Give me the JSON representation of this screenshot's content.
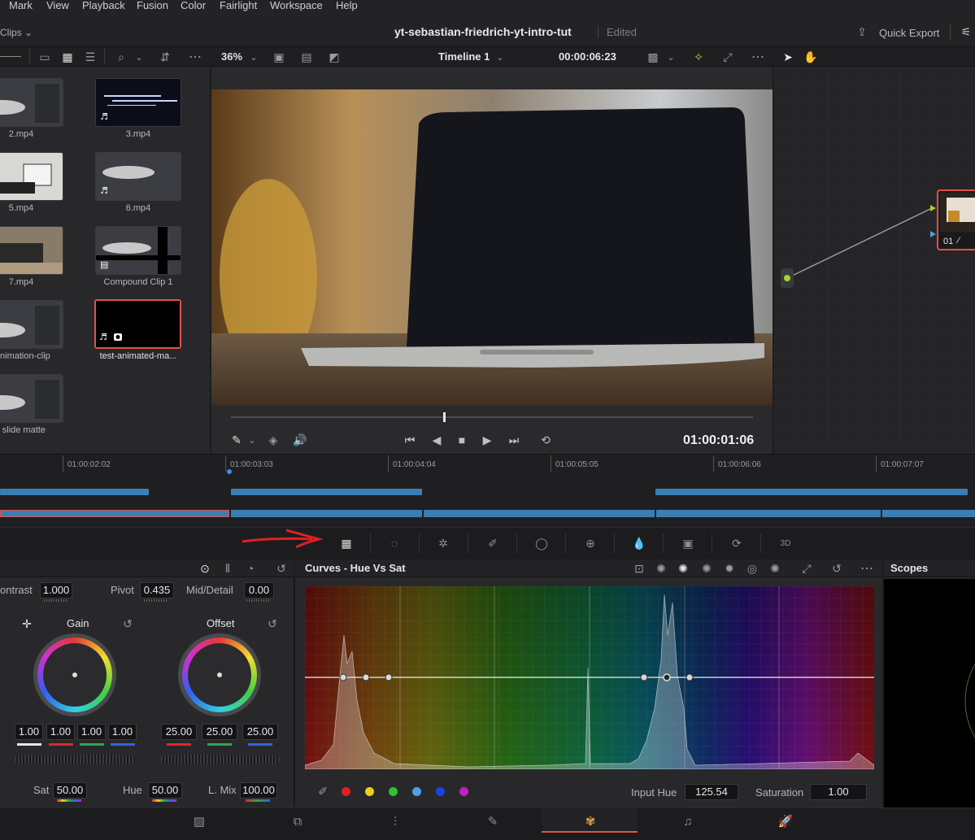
{
  "menu": [
    "Mark",
    "View",
    "Playback",
    "Fusion",
    "Color",
    "Fairlight",
    "Workspace",
    "Help"
  ],
  "title": {
    "project": "yt-sebastian-friedrich-yt-intro-tut",
    "status": "Edited",
    "quick_export": "Quick Export",
    "clips_label": "Clips"
  },
  "viewer": {
    "zoom": "36%",
    "timeline": "Timeline 1",
    "timecode": "00:00:06:23",
    "current_tc": "01:00:01:06"
  },
  "media": [
    {
      "name": "2.mp4"
    },
    {
      "name": "3.mp4"
    },
    {
      "name": "5.mp4"
    },
    {
      "name": "6.mp4"
    },
    {
      "name": "7.mp4"
    },
    {
      "name": "Compound Clip 1"
    },
    {
      "name": "-animation-clip"
    },
    {
      "name": "test-animated-ma..."
    },
    {
      "name": "- slide matte"
    }
  ],
  "node": {
    "label": "01"
  },
  "timeline": {
    "ticks": [
      "01:00:02:02",
      "01:00:03:03",
      "01:00:04:04",
      "01:00:05:05",
      "01:00:06:06",
      "01:00:07:07"
    ]
  },
  "primaries": {
    "contrast_label": "ontrast",
    "contrast": "1.000",
    "pivot_label": "Pivot",
    "pivot": "0.435",
    "middetail_label": "Mid/Detail",
    "middetail": "0.00",
    "gain_label": "Gain",
    "gain": [
      "1.00",
      "1.00",
      "1.00",
      "1.00"
    ],
    "offset_label": "Offset",
    "offset": [
      "25.00",
      "25.00",
      "25.00"
    ],
    "sat_label": "Sat",
    "sat": "50.00",
    "hue_label": "Hue",
    "hue": "50.00",
    "lmix_label": "L. Mix",
    "lmix": "100.00"
  },
  "curves": {
    "title": "Curves - Hue Vs Sat",
    "input_hue_label": "Input Hue",
    "input_hue": "125.54",
    "saturation_label": "Saturation",
    "saturation": "1.00",
    "swatches": [
      "#e02020",
      "#e8d020",
      "#30c030",
      "#50a0e8",
      "#2040e8",
      "#c020c0"
    ]
  },
  "scopes": {
    "title": "Scopes"
  },
  "colors": {
    "accent": "#e0524a",
    "clip_blue": "#3a7fb3"
  }
}
